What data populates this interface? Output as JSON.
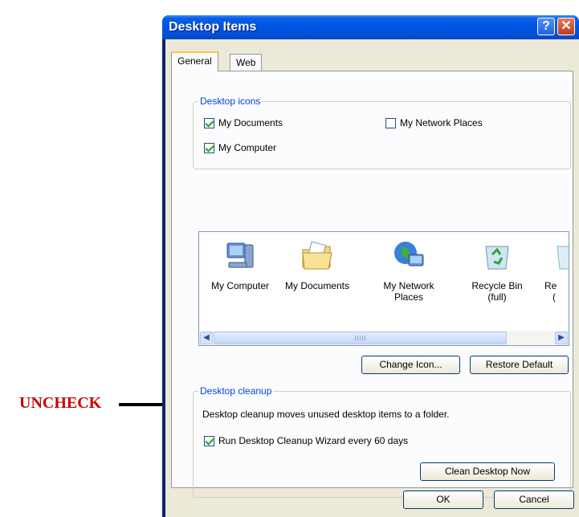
{
  "annotation": {
    "label": "UNCHECK"
  },
  "window": {
    "title": "Desktop Items",
    "help_glyph": "?",
    "close_glyph": "✕"
  },
  "tabs": [
    {
      "label": "General",
      "active": true
    },
    {
      "label": "Web",
      "active": false
    }
  ],
  "desktop_icons": {
    "title": "Desktop icons",
    "checkboxes": [
      {
        "label": "My Documents",
        "checked": true
      },
      {
        "label": "My Network Places",
        "checked": false
      },
      {
        "label": "My Computer",
        "checked": true
      }
    ]
  },
  "icon_list": {
    "items": [
      {
        "label": "My Computer",
        "icon": "my-computer-icon"
      },
      {
        "label": "My Documents",
        "icon": "my-documents-icon"
      },
      {
        "label": "My Network Places",
        "icon": "my-network-places-icon"
      },
      {
        "label": "Recycle Bin (full)",
        "icon": "recycle-bin-full-icon"
      },
      {
        "label": "Re(",
        "icon": "recycle-bin-icon"
      }
    ],
    "item_lines": [
      [
        "My Computer"
      ],
      [
        "My Documents"
      ],
      [
        "My Network",
        "Places"
      ],
      [
        "Recycle Bin",
        "(full)"
      ],
      [
        "Re",
        "("
      ]
    ]
  },
  "buttons": {
    "change_icon": "Change Icon...",
    "restore_default": "Restore Default",
    "clean_desktop_now": "Clean Desktop Now",
    "ok": "OK",
    "cancel": "Cancel"
  },
  "desktop_cleanup": {
    "title": "Desktop cleanup",
    "description": "Desktop cleanup moves unused desktop items to a folder.",
    "wizard_checkbox": {
      "label": "Run Desktop Cleanup Wizard every 60 days",
      "checked": true
    }
  },
  "colors": {
    "annotation": "#cc0000",
    "titlebar": "#0054e3",
    "group_title": "#0046d5",
    "dialog_face": "#ece9d8"
  }
}
